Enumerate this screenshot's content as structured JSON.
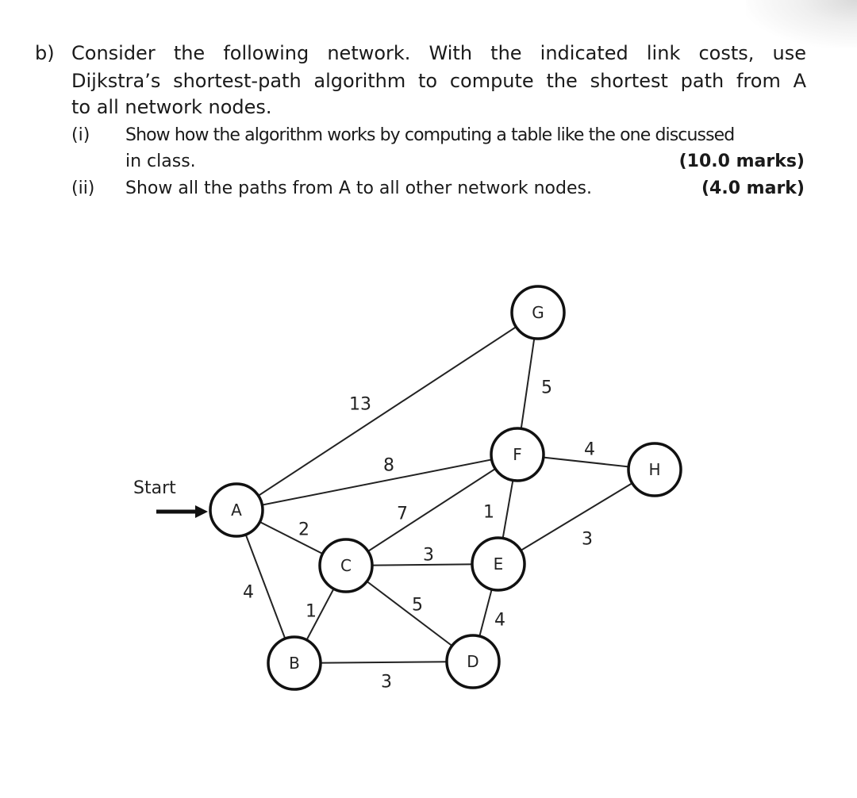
{
  "question": {
    "label": "b)",
    "lines": [
      "Consider the following network. With the indicated link costs, use",
      "Dijkstra’s shortest-path algorithm to compute the shortest path from A",
      "to all network nodes."
    ],
    "parts": [
      {
        "number": "(i)",
        "line1": "Show how the algorithm works by computing a table like the one discussed",
        "line2": "in class.",
        "marks": "(10.0 marks)"
      },
      {
        "number": "(ii)",
        "line1": "Show all the paths from A to all other network nodes.",
        "marks": "(4.0 mark)"
      }
    ]
  },
  "graph": {
    "start_label": "Start",
    "start_node": "A",
    "nodes": [
      "A",
      "B",
      "C",
      "D",
      "E",
      "F",
      "G",
      "H"
    ],
    "edges": [
      {
        "from": "A",
        "to": "G",
        "cost": "13"
      },
      {
        "from": "A",
        "to": "F",
        "cost": "8"
      },
      {
        "from": "A",
        "to": "C",
        "cost": "2"
      },
      {
        "from": "A",
        "to": "B",
        "cost": "4"
      },
      {
        "from": "B",
        "to": "C",
        "cost": "1"
      },
      {
        "from": "B",
        "to": "D",
        "cost": "3"
      },
      {
        "from": "C",
        "to": "F",
        "cost": "7"
      },
      {
        "from": "C",
        "to": "E",
        "cost": "3"
      },
      {
        "from": "C",
        "to": "D",
        "cost": "5"
      },
      {
        "from": "F",
        "to": "E",
        "cost": "1"
      },
      {
        "from": "E",
        "to": "D",
        "cost": "4"
      },
      {
        "from": "G",
        "to": "F",
        "cost": "5"
      },
      {
        "from": "F",
        "to": "H",
        "cost": "4"
      },
      {
        "from": "E",
        "to": "H",
        "cost": "3"
      }
    ]
  }
}
